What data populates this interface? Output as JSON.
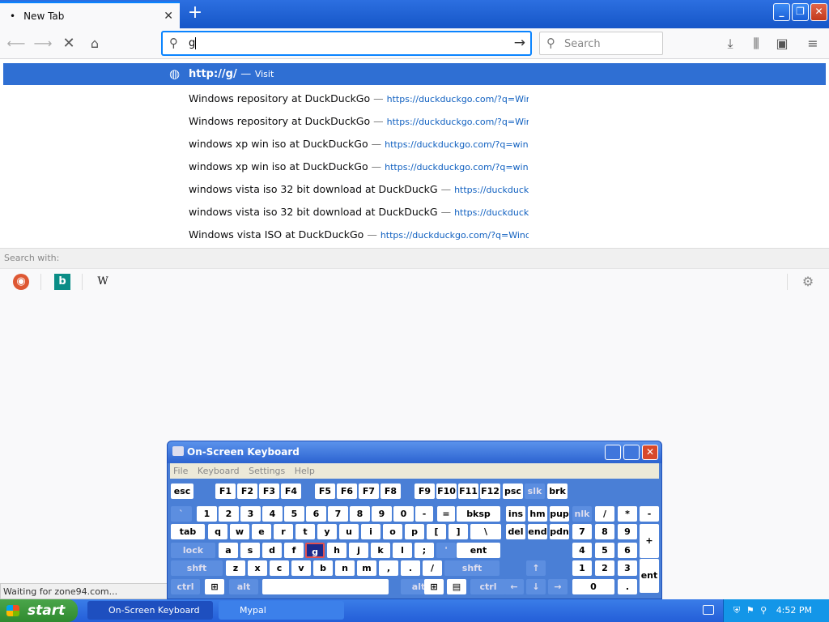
{
  "tab": {
    "title": "New Tab",
    "close": "✕",
    "new": "+"
  },
  "window": {
    "min": "_",
    "restore": "❐",
    "close": "✕"
  },
  "nav": {
    "url_value": "g",
    "search_placeholder": "Search"
  },
  "popup": {
    "heading_url": "http://g/",
    "heading_dash": "—",
    "heading_action": "Visit",
    "rows": [
      {
        "text": "Windows repository at DuckDuckGo",
        "url": "https://duckduckgo.com/?q=Windows+r"
      },
      {
        "text": "Windows repository at DuckDuckGo",
        "url": "https://duckduckgo.com/?q=Windows+r"
      },
      {
        "text": "windows xp win iso at DuckDuckGo",
        "url": "https://duckduckgo.com/?q=windows+x"
      },
      {
        "text": "windows xp win iso at DuckDuckGo",
        "url": "https://duckduckgo.com/?q=windows+x"
      },
      {
        "text": "windows vista iso 32 bit download at DuckDuckG",
        "url": "https://duckduckgo.com"
      },
      {
        "text": "windows vista iso 32 bit download at DuckDuckG",
        "url": "https://duckduckgo.com"
      },
      {
        "text": "Windows vista ISO at DuckDuckGo",
        "url": "https://duckduckgo.com/?q=Windows+v"
      }
    ],
    "search_with": "Search with:",
    "engine_wiki": "W"
  },
  "status": "Waiting for zone94.com...",
  "osk": {
    "title": "On-Screen Keyboard",
    "menu": [
      "File",
      "Keyboard",
      "Settings",
      "Help"
    ],
    "row0": [
      "esc",
      "F1",
      "F2",
      "F3",
      "F4",
      "F5",
      "F6",
      "F7",
      "F8",
      "F9",
      "F10",
      "F11",
      "F12",
      "psc",
      "slk",
      "brk"
    ],
    "row1": [
      "`",
      "1",
      "2",
      "3",
      "4",
      "5",
      "6",
      "7",
      "8",
      "9",
      "0",
      "-",
      "=",
      "bksp",
      "ins",
      "hm",
      "pup",
      "nlk",
      "/",
      "*",
      "-"
    ],
    "row2": [
      "tab",
      "q",
      "w",
      "e",
      "r",
      "t",
      "y",
      "u",
      "i",
      "o",
      "p",
      "[",
      "]",
      "\\",
      "del",
      "end",
      "pdn",
      "7",
      "8",
      "9",
      "+"
    ],
    "row3": [
      "lock",
      "a",
      "s",
      "d",
      "f",
      "g",
      "h",
      "j",
      "k",
      "l",
      ";",
      "'",
      "ent",
      "4",
      "5",
      "6"
    ],
    "row4": [
      "shft",
      "z",
      "x",
      "c",
      "v",
      "b",
      "n",
      "m",
      ",",
      ".",
      "/",
      "shft",
      "↑",
      "1",
      "2",
      "3",
      "ent"
    ],
    "row5": [
      "ctrl",
      "alt",
      "alt",
      "ctrl",
      "←",
      "↓",
      "→",
      "0",
      "."
    ]
  },
  "taskbar": {
    "start": "start",
    "items": [
      "On-Screen Keyboard",
      "Mypal"
    ],
    "time": "4:52 PM"
  }
}
